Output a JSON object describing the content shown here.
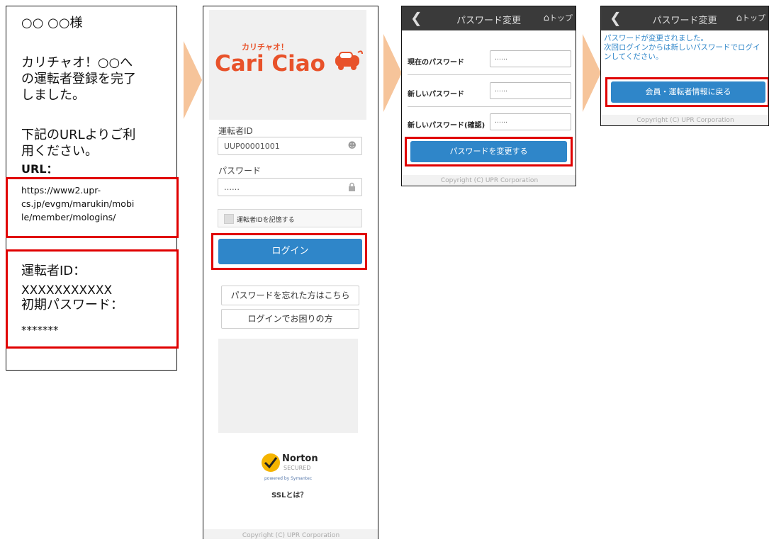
{
  "email": {
    "greeting": "○○ ○○様",
    "line1": "カリチャオ！○○へ",
    "line2": "の運転者登録を完了",
    "line3": "しました。",
    "line4": "下記のURLよりご利",
    "line5": "用ください。",
    "url_label": "URL：",
    "url_1": "https://www2.upr-",
    "url_2": "cs.jp/evgm/marukin/mobi",
    "url_3": "le/member/mologins/",
    "id_label": "運転者ID：",
    "id_value": "XXXXXXXXXXX",
    "pw_label": "初期パスワード：",
    "pw_value": "*******"
  },
  "login": {
    "logo_small": "カリチャオ！",
    "logo_main": "Cari Ciao",
    "id_label": "運転者ID",
    "id_value": "UUP00001001",
    "pw_label": "パスワード",
    "pw_value": "……",
    "remember_label": "運転者IDを記憶する",
    "login_button": "ログイン",
    "forgot_button": "パスワードを忘れた方はこちら",
    "trouble_button": "ログインでお困りの方",
    "norton_top": "Norton",
    "norton_bottom": "SECURED",
    "norton_powered": "powered by Symantec",
    "ssl_link": "SSLとは？",
    "copyright": "Copyright (C) UPR Corporation"
  },
  "change_pw": {
    "title": "パスワード変更",
    "home_label": "トップ",
    "current_label": "現在のパスワード",
    "current_value": "……",
    "new_label": "新しいパスワード",
    "new_value": "……",
    "confirm_label": "新しいパスワード(確認)",
    "confirm_value": "……",
    "submit_button": "パスワードを変更する",
    "copyright": "Copyright (C) UPR Corporation"
  },
  "done": {
    "title": "パスワード変更",
    "home_label": "トップ",
    "msg1": "パスワードが変更されました。",
    "msg2": "次回ログインからは新しいパスワードでログイ",
    "msg3": "ンしてください。",
    "back_button": "会員・運転者情報に戻る",
    "copyright": "Copyright (C) UPR Corporation"
  },
  "colors": {
    "highlight": "#e00000",
    "primary": "#2f86c9",
    "navbar": "#3a3a3a",
    "arrow": "#f6c49a"
  }
}
